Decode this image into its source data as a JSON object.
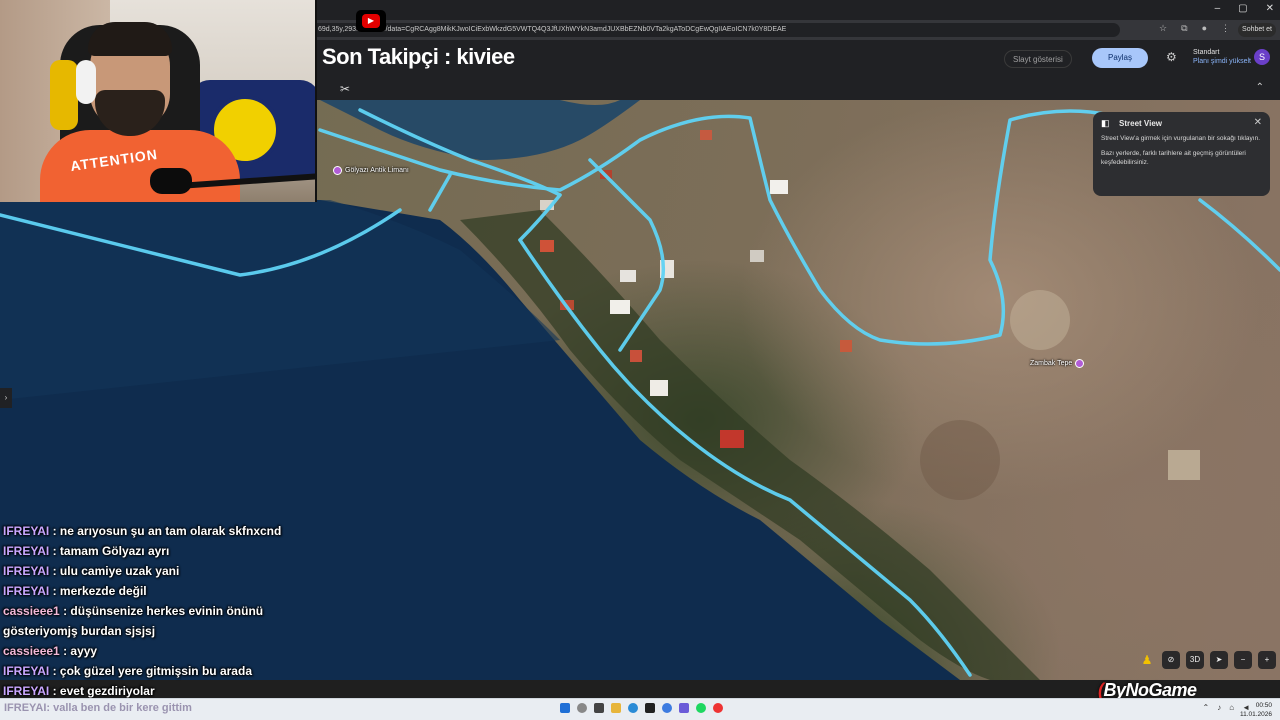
{
  "browser": {
    "url": "69d,35y,293.....h,0t,0r/data=CgRCAgg8MikKJwoICiExbWkzdG5VWTQ4Q3JfUXhWYkN3amdJUXBbEZNb0VTa2kgAToDCgEwQgIIAEoICN7k0Y8DEAE",
    "chat_button": "Sohbet et",
    "window_controls": [
      "–",
      "▢",
      "✕"
    ]
  },
  "stream": {
    "title": "Son Takipçi : kiviee",
    "watermark_prefix": "(",
    "watermark": "ByNoGame"
  },
  "maps_header": {
    "slideshow_label": "Slayt gösterisi",
    "share_label": "Paylaş",
    "plan_title": "Standart",
    "plan_subtitle": "Planı şimdi yükselt",
    "avatar_letter": "S"
  },
  "map": {
    "labels": {
      "harbor": "Gölyazı Antik Limanı",
      "hill": "Zambak Tepe"
    },
    "controls": {
      "three_d": "3D",
      "zoom_out": "−",
      "zoom_in": "+"
    }
  },
  "street_view": {
    "title": "Street View",
    "text1": "Street View'a girmek için vurgulanan bir sokağı tıklayın.",
    "text2": "Bazı yerlerde, farklı tarihlere ait geçmiş görüntüleri keşfedebilirsiniz."
  },
  "webcam": {
    "shirt_text": "ATTENTION"
  },
  "chat": {
    "messages": [
      {
        "user": "IFREYAI",
        "text": ": ne arıyosun şu an tam olarak skfnxcnd"
      },
      {
        "user": "IFREYAI",
        "text": ": tamam Gölyazı ayrı"
      },
      {
        "user": "IFREYAI",
        "text": ": ulu camiye uzak yani"
      },
      {
        "user": "IFREYAI",
        "text": ": merkezde değil"
      },
      {
        "user": "cassieee1",
        "text": ": düşünsenize herkes evinin önünü"
      },
      {
        "user": "",
        "text": "gösteriyomjş burdan sjsjsj"
      },
      {
        "user": "cassieee1",
        "text": ": ayyy"
      },
      {
        "user": "IFREYAI",
        "text": ": çok güzel yere gitmişsin bu arada"
      },
      {
        "user": "IFREYAI",
        "text": ": evet gezdiriyolar"
      }
    ],
    "partial": "IFREYAI: valla ben de bir kere gittim"
  },
  "taskbar": {
    "time": "00:50",
    "date": "11.01.2026"
  },
  "colors": {
    "road_highlight": "#5fd3f5",
    "accent": "#a8c7fa",
    "username": "#c9a6ff"
  }
}
